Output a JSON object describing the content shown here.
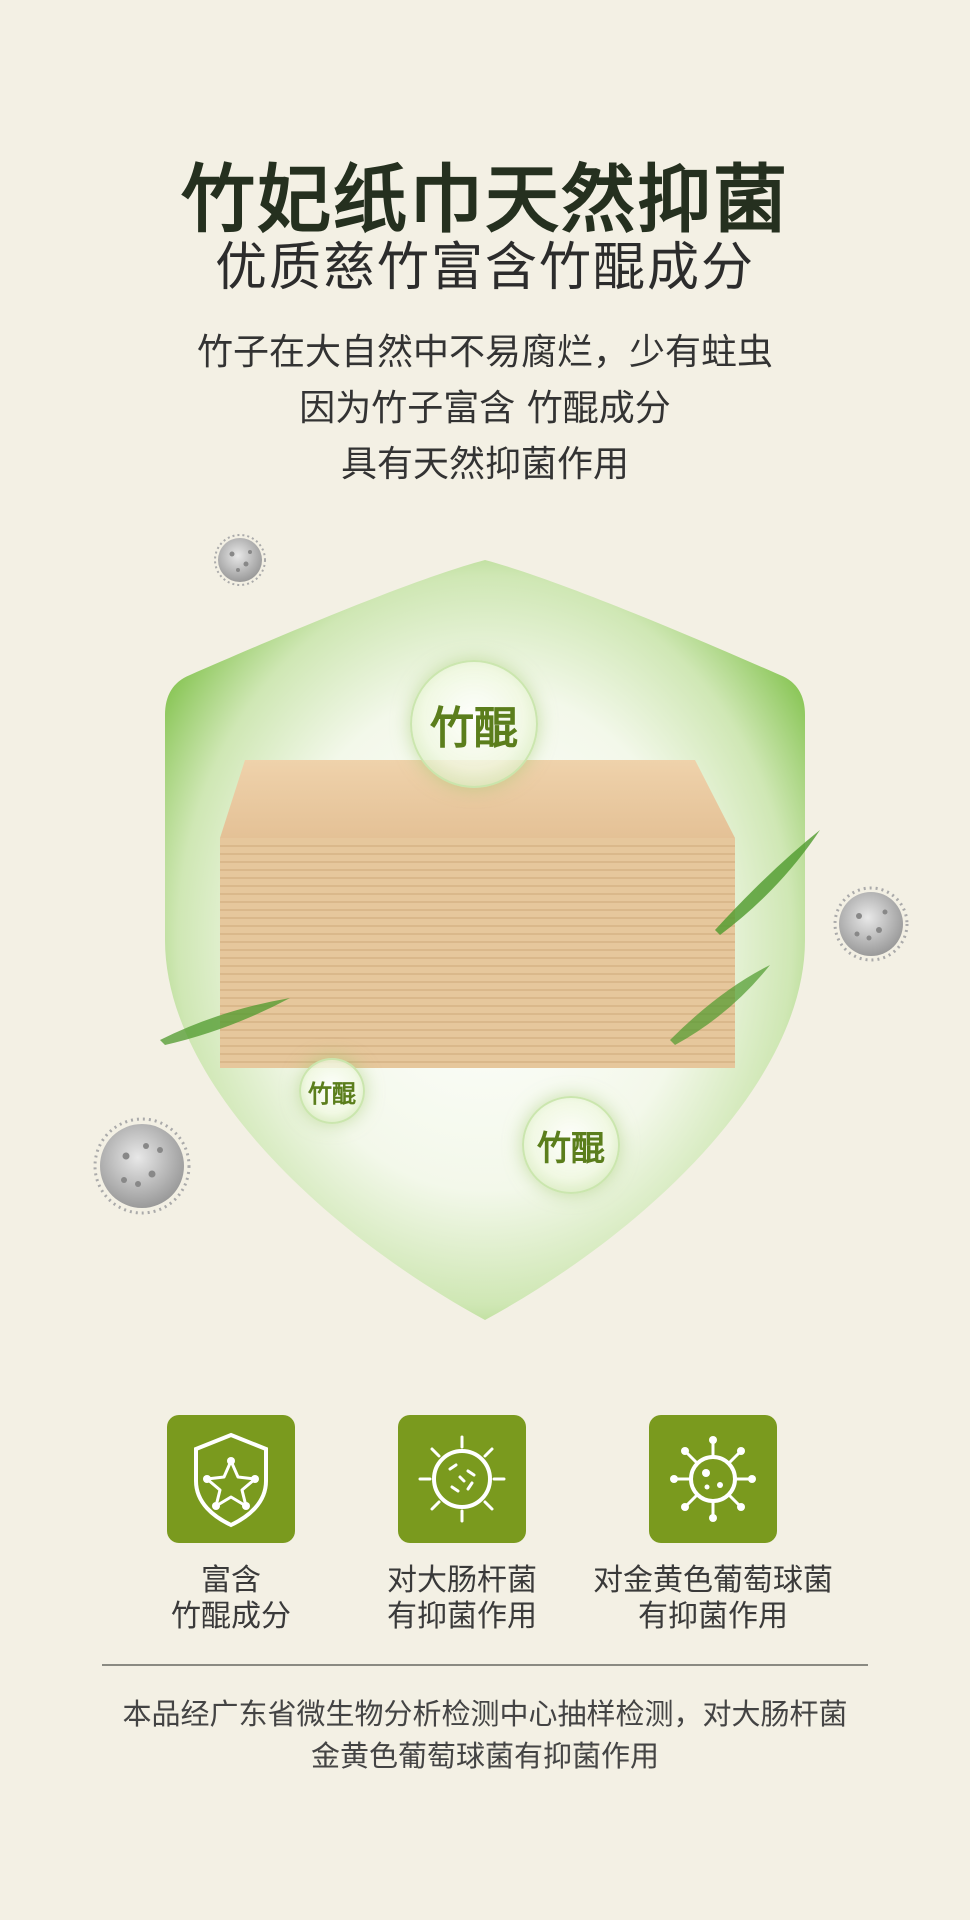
{
  "header": {
    "title": "竹妃纸巾天然抑菌",
    "subtitle": "优质慈竹富含竹醌成分"
  },
  "description": {
    "lines": [
      "竹子在大自然中不易腐烂，少有蛀虫",
      "因为竹子富含 竹醌成分",
      "具有天然抑菌作用"
    ]
  },
  "hero": {
    "bubbles": [
      "竹醌",
      "竹醌",
      "竹醌"
    ],
    "colors": {
      "shield_outer": "#7fbf4a",
      "shield_inner": "#ffffff",
      "tissue": "#e8c9a0",
      "bubble_text": "#5b7e1c"
    }
  },
  "features": [
    {
      "icon": "shield-star-icon",
      "line1": "富含",
      "line2": "竹醌成分"
    },
    {
      "icon": "bacteria-icon",
      "line1": "对大肠杆菌",
      "line2": "有抑菌作用"
    },
    {
      "icon": "virus-icon",
      "line1": "对金黄色葡萄球菌",
      "line2": "有抑菌作用"
    }
  ],
  "footnote": {
    "line1": "本品经广东省微生物分析检测中心抽样检测，对大肠杆菌",
    "line2": "金黄色葡萄球菌有抑菌作用"
  },
  "theme": {
    "background": "#f3f0e4",
    "accent": "#7a9a1e"
  }
}
